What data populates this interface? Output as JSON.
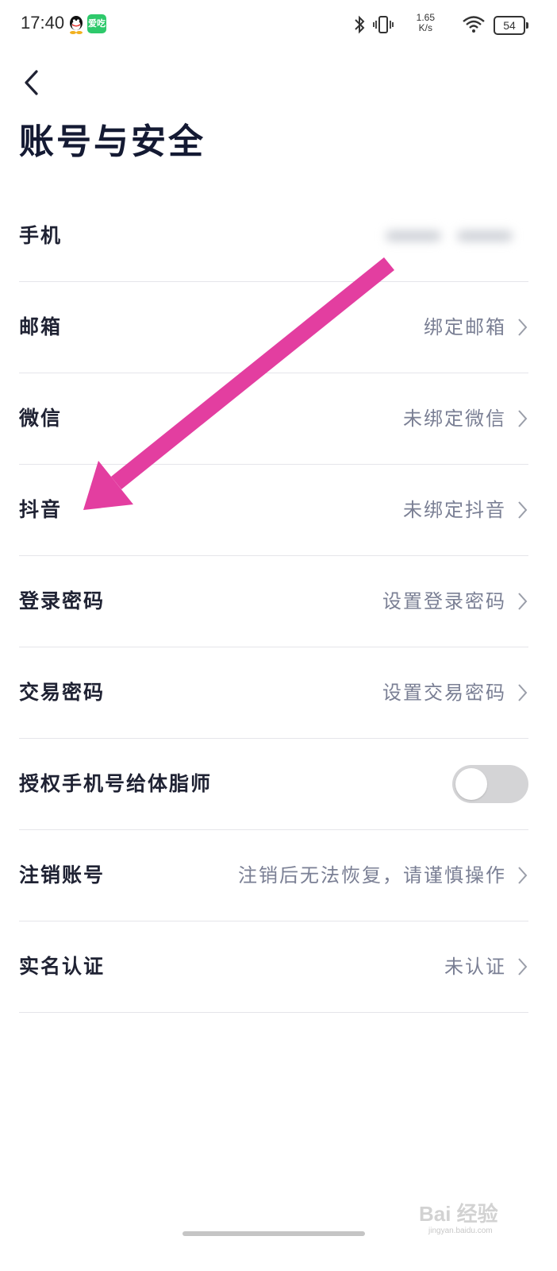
{
  "status_bar": {
    "time": "17:40",
    "network_speed_value": "1.65",
    "network_speed_unit": "K/s",
    "battery": "54",
    "icons": [
      "qq-icon",
      "app-icon",
      "bluetooth-icon",
      "vibrate-icon",
      "wifi-icon",
      "battery-icon"
    ],
    "app_badge_text": "爱吃"
  },
  "header": {
    "back_icon": "chevron-left-icon",
    "title": "账号与安全"
  },
  "rows": [
    {
      "label": "手机",
      "value": ""
    },
    {
      "label": "邮箱",
      "value": "绑定邮箱"
    },
    {
      "label": "微信",
      "value": "未绑定微信"
    },
    {
      "label": "抖音",
      "value": "未绑定抖音"
    },
    {
      "label": "登录密码",
      "value": "设置登录密码"
    },
    {
      "label": "交易密码",
      "value": "设置交易密码"
    },
    {
      "label": "授权手机号给体脂师",
      "toggle_on": false
    },
    {
      "label": "注销账号",
      "value": "注销后无法恢复，请谨慎操作"
    },
    {
      "label": "实名认证",
      "value": "未认证"
    }
  ],
  "annotation": {
    "icon": "pink-arrow-icon",
    "color": "#e33ea0"
  },
  "watermark": {
    "brand": "Bai 经验",
    "url": "jingyan.baidu.com"
  },
  "colors": {
    "title": "#141a33",
    "label": "#1f2233",
    "value": "#7a7f94",
    "divider": "#e5e5ea",
    "toggle_off": "#d4d4d6"
  }
}
